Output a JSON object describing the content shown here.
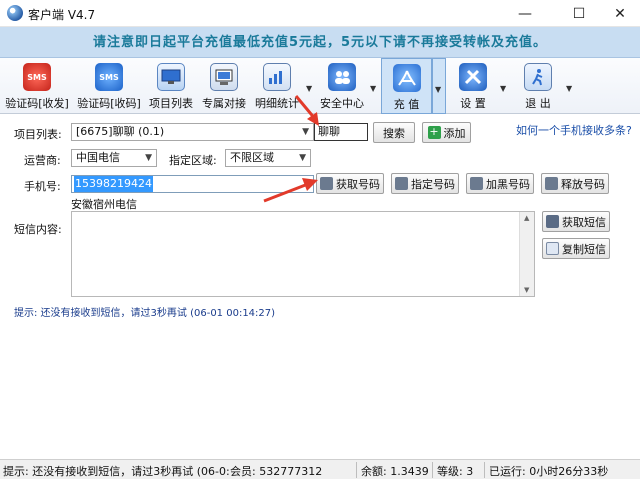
{
  "window": {
    "title": "客户端 V4.7"
  },
  "notice": "请注意即日起平台充值最低充值5元起，5元以下请不再接受转帐及充值。",
  "toolbar": {
    "items": [
      {
        "label": "验证码[收发]"
      },
      {
        "label": "验证码[收码]"
      },
      {
        "label": "项目列表"
      },
      {
        "label": "专属对接"
      },
      {
        "label": "明细统计"
      },
      {
        "label": "安全中心"
      },
      {
        "label": "充 值"
      },
      {
        "label": "设 置"
      },
      {
        "label": "退 出"
      }
    ]
  },
  "form": {
    "project_label": "项目列表:",
    "project_value": "[6675]聊聊 (0.1)",
    "search_value": "聊聊",
    "search_button": "搜索",
    "add_button": "添加",
    "help_link": "如何一个手机接收多条?",
    "operator_label": "运营商:",
    "operator_value": "中国电信",
    "region_label": "指定区域:",
    "region_value": "不限区域",
    "phone_label": "手机号:",
    "phone_value": "15398219424",
    "phone_location": "安徽宿州电信",
    "get_number_button": "获取号码",
    "assign_number_button": "指定号码",
    "blacklist_button": "加黑号码",
    "release_button": "释放号码",
    "sms_label": "短信内容:",
    "get_sms_button": "获取短信",
    "copy_sms_button": "复制短信",
    "tip": "提示: 还没有接收到短信，请过3秒再试 (06-01 00:14:27)"
  },
  "statusbar": {
    "message": "提示: 还没有接收到短信，请过3秒再试 (06-0:",
    "member": "会员: 532777312",
    "balance": "余额: 1.3439",
    "level": "等级: 3",
    "running": "已运行: 0小时26分33秒"
  },
  "colors": {
    "notice_bg": "#c8ddf2",
    "notice_text": "#1a7a9a",
    "selection": "#3399ff",
    "arrow": "#e23a2a"
  }
}
